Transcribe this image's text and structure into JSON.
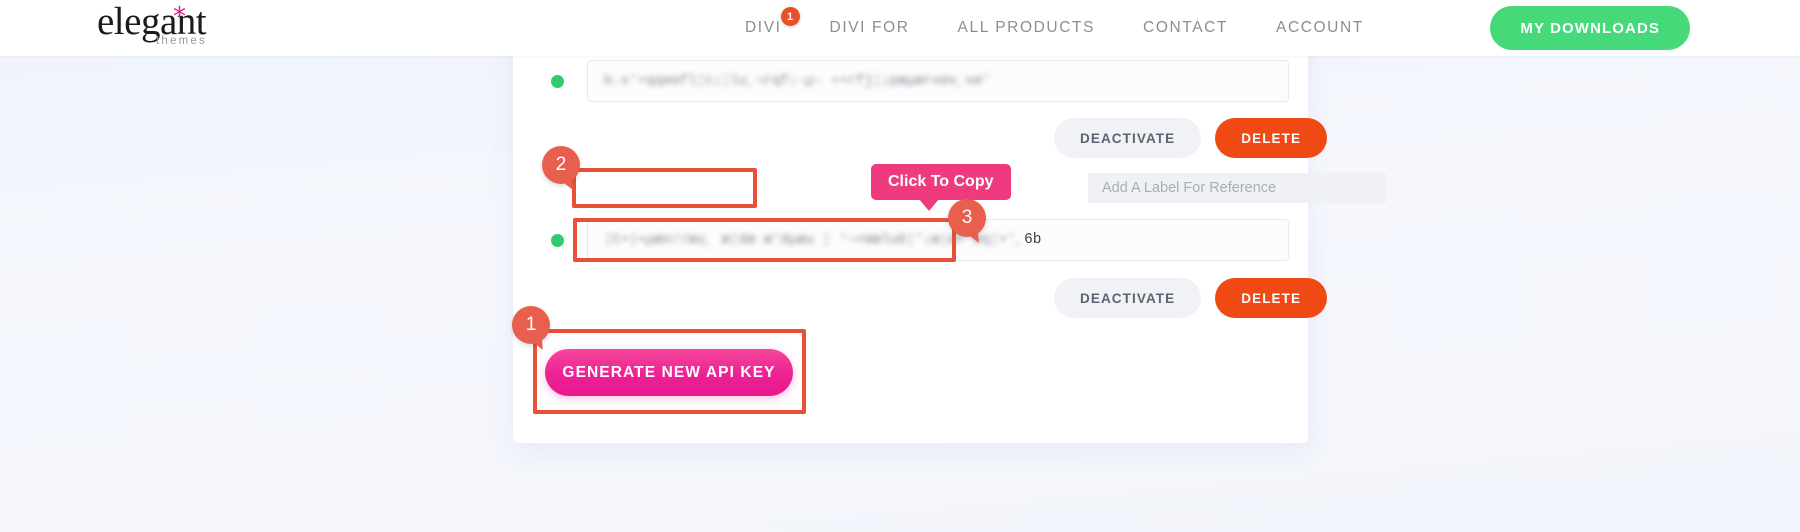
{
  "header": {
    "logo": {
      "word": "elegant",
      "star": "*",
      "sub": "themes"
    },
    "nav": [
      {
        "label": "DIVI",
        "badge": "1"
      },
      {
        "label": "DIVI FOR",
        "badge": null
      },
      {
        "label": "ALL PRODUCTS",
        "badge": null
      },
      {
        "label": "CONTACT",
        "badge": null
      },
      {
        "label": "ACCOUNT",
        "badge": null
      }
    ],
    "downloads_button": "MY DOWNLOADS"
  },
  "api_keys": {
    "rows": [
      {
        "status": "active",
        "key_masked": "b.x'•qqøafl¦c¡¦lu¸¬rqf¡-µ- ••rfj¦¡pæµærvøv¸vø'",
        "key_tail": "",
        "deactivate_label": "DEACTIVATE",
        "delete_label": "DELETE"
      },
      {
        "status": "active",
        "key_masked": "¦C•|•µæn//æu¸ æ¦dæ æ'dµæu ¦ '¬•Wæluê¦'¡æ¦ær æq¦•'¸",
        "key_tail": "6b",
        "deactivate_label": "DEACTIVATE",
        "delete_label": "DELETE"
      }
    ],
    "label_input": {
      "value": "",
      "placeholder": "Add A Label For Reference"
    },
    "copy_tooltip": "Click To Copy",
    "generate_button": "GENERATE NEW API KEY"
  },
  "annotations": [
    {
      "id": "1",
      "target": "generate-new-api-key-button"
    },
    {
      "id": "2",
      "target": "label-input"
    },
    {
      "id": "3",
      "target": "api-key-field-2"
    }
  ],
  "colors": {
    "accent_pink": "#ec2293",
    "accent_green": "#45d97a",
    "delete_orange": "#ef4a14",
    "annotation_red": "#e8503a",
    "badge_red": "#e8604d",
    "status_green": "#2ecc71",
    "tooltip_pink": "#ee3b80"
  }
}
